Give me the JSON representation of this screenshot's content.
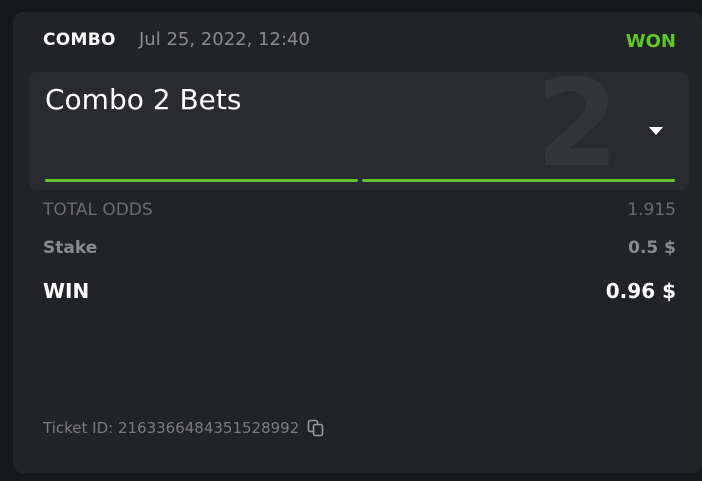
{
  "header": {
    "bet_type": "COMBO",
    "date": "Jul 25, 2022, 12:40",
    "status": "WON"
  },
  "combo": {
    "title": "Combo 2 Bets",
    "count": "2",
    "legs_progress": [
      1,
      1
    ]
  },
  "summary": {
    "total_odds_label": "TOTAL ODDS",
    "total_odds_value": "1.915",
    "stake_label": "Stake",
    "stake_value": "0.5 $",
    "win_label": "WIN",
    "win_value": "0.96 $"
  },
  "ticket": {
    "label": "Ticket ID: 2163366484351528992",
    "copy_icon": "copy-icon"
  },
  "colors": {
    "background": "#17181b",
    "card": "#222327",
    "panel": "#2a2b2f",
    "accent_green": "#5fc72c"
  }
}
